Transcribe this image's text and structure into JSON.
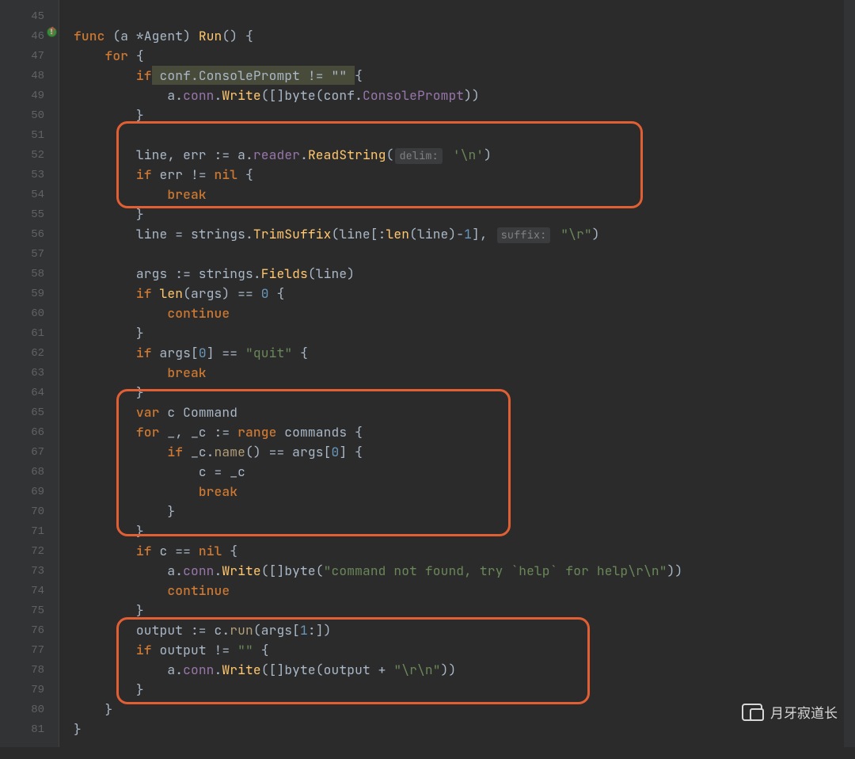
{
  "line_start": 45,
  "line_end": 81,
  "gutter": {
    "warn_line": 46
  },
  "watermark_text": "月牙寂道长",
  "hints": {
    "delim": "delim:",
    "suffix": "suffix:"
  },
  "code": {
    "l46": {
      "kw_func": "func",
      "recv": "(a *Agent)",
      "method": "Run",
      "paren": "()",
      "brace": " {"
    },
    "l47": {
      "kw_for": "for",
      "brace": " {"
    },
    "l48": {
      "kw_if": "if",
      "expr": " conf.ConsolePrompt != \"\" ",
      "brace": "{"
    },
    "l49": {
      "txt": "a.",
      "fld": "conn",
      "dot": ".",
      "call": "Write",
      "args": "([]byte(conf.",
      "fld2": "ConsolePrompt",
      "end": "))"
    },
    "l50": {
      "brace": "}"
    },
    "l52": {
      "lhs": "line, err",
      "op": ":= ",
      "rhs_a": "a.",
      "fld": "reader",
      "dot": ".",
      "call": "ReadString",
      "open": "(",
      "str": "'\\n'",
      "close": ")"
    },
    "l53": {
      "kw_if": "if",
      "expr": " err != ",
      "kw_nil": "nil",
      "brace": " {"
    },
    "l54": {
      "kw_break": "break"
    },
    "l55": {
      "brace": "}"
    },
    "l56": {
      "lhs": "line = strings.",
      "call": "TrimSuffix",
      "open": "(line[:",
      "call2": "len",
      "mid": "(line)-",
      "num": "1",
      "close": "],",
      "str": " \"\\r\"",
      "end": ")"
    },
    "l58": {
      "lhs": "args := strings.",
      "call": "Fields",
      "args": "(line)"
    },
    "l59": {
      "kw_if": "if",
      "sp": " ",
      "call": "len",
      "open": "(args) == ",
      "num": "0",
      "brace": " {"
    },
    "l60": {
      "kw_continue": "continue"
    },
    "l61": {
      "brace": "}"
    },
    "l62": {
      "kw_if": "if",
      "expr": " args[",
      "num": "0",
      "mid": "] == ",
      "str": "\"quit\"",
      "brace": " {"
    },
    "l63": {
      "kw_break": "break"
    },
    "l64": {
      "brace": "}"
    },
    "l65": {
      "kw_var": "var",
      "sp": " c ",
      "type": "Command"
    },
    "l66": {
      "kw_for": "for",
      "lhs": " _, _c := ",
      "kw_range": "range",
      "rhs": " commands",
      "brace": " {"
    },
    "l67": {
      "kw_if": "if",
      "lhs": " _c.",
      "call": "name",
      "mid": "() == args[",
      "num": "0",
      "close": "]",
      "brace": " {"
    },
    "l68": {
      "txt": "c = _c"
    },
    "l69": {
      "kw_break": "break"
    },
    "l70": {
      "brace": "}"
    },
    "l71": {
      "brace": "}"
    },
    "l72": {
      "kw_if": "if",
      "expr": " c == ",
      "kw_nil": "nil",
      "brace": " {"
    },
    "l73": {
      "txt": "a.",
      "fld": "conn",
      "dot": ".",
      "call": "Write",
      "open": "([]byte(",
      "str": "\"command not found, try `help` for help\\r\\n\"",
      "close": "))"
    },
    "l74": {
      "kw_continue": "continue"
    },
    "l75": {
      "brace": "}"
    },
    "l76": {
      "lhs": "output := c.",
      "call": "run",
      "open": "(args[",
      "num": "1",
      "close": ":])"
    },
    "l77": {
      "kw_if": "if",
      "expr": " output != ",
      "str": "\"\"",
      "brace": " {"
    },
    "l78": {
      "txt": "a.",
      "fld": "conn",
      "dot": ".",
      "call": "Write",
      "open": "([]byte(output + ",
      "str": "\"\\r\\n\"",
      "close": "))"
    },
    "l79": {
      "brace": "}"
    },
    "l80": {
      "brace": "}"
    },
    "l81": {
      "brace": "}"
    }
  }
}
